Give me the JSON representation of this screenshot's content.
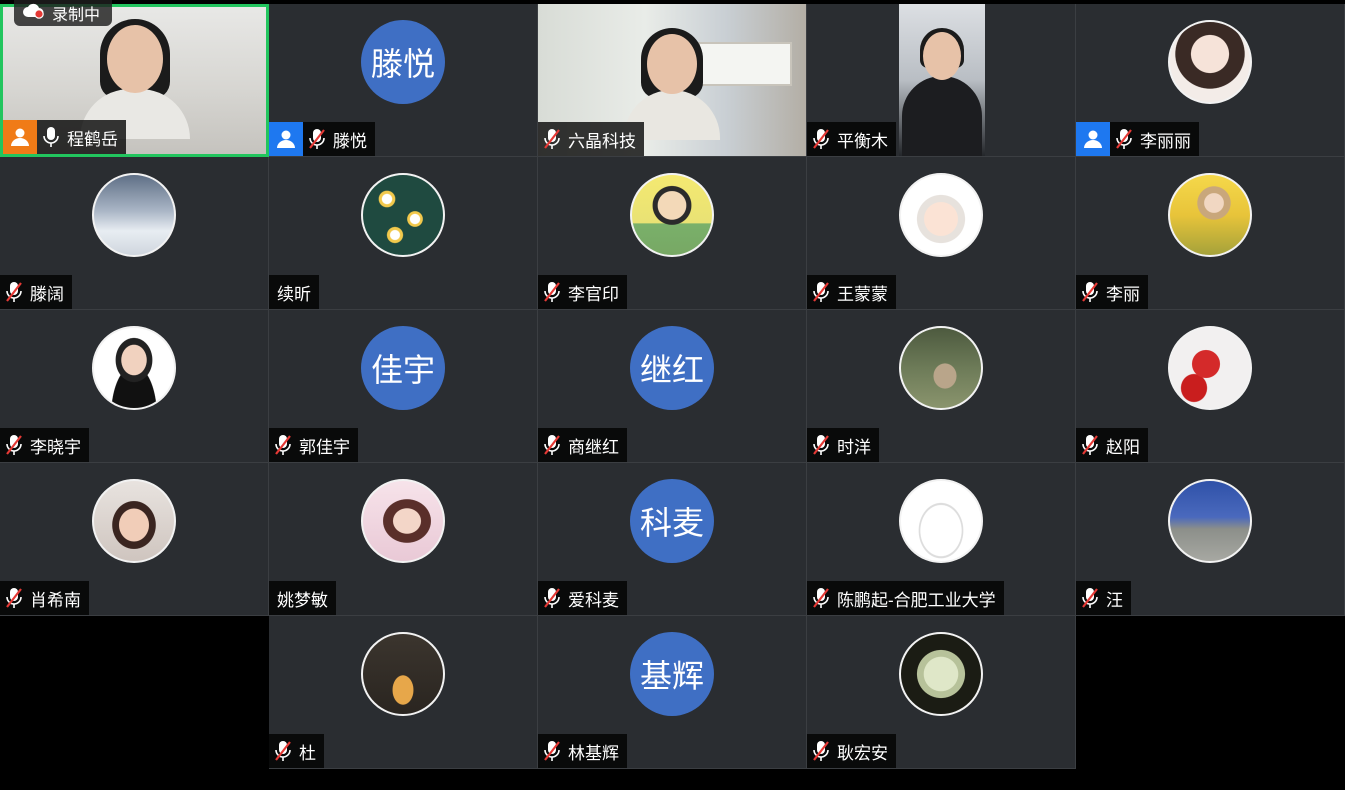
{
  "recording": {
    "label": "录制中",
    "icon": "cloud-record-icon"
  },
  "colors": {
    "active_border": "#22c55e",
    "initials_bg": "#3f6fc4",
    "host_badge": "#f07b17",
    "user_badge": "#1e78f0"
  },
  "participants": [
    {
      "name": "程鹤岳",
      "kind": "video",
      "mic": "on",
      "badge": "host"
    },
    {
      "name": "滕悦",
      "kind": "initials",
      "initials": "滕悦",
      "mic": "muted",
      "badge": "user"
    },
    {
      "name": "六晶科技",
      "kind": "video",
      "mic": "muted",
      "badge": ""
    },
    {
      "name": "平衡木",
      "kind": "video",
      "mic": "muted",
      "badge": ""
    },
    {
      "name": "李丽丽",
      "kind": "avatar",
      "mic": "muted",
      "badge": "user"
    },
    {
      "name": "滕阔",
      "kind": "avatar",
      "mic": "muted",
      "badge": ""
    },
    {
      "name": "续昕",
      "kind": "avatar",
      "mic": "none",
      "badge": ""
    },
    {
      "name": "李官印",
      "kind": "avatar",
      "mic": "muted",
      "badge": ""
    },
    {
      "name": "王蒙蒙",
      "kind": "avatar",
      "mic": "muted",
      "badge": ""
    },
    {
      "name": "李丽",
      "kind": "avatar",
      "mic": "muted",
      "badge": ""
    },
    {
      "name": "李晓宇",
      "kind": "avatar",
      "mic": "muted",
      "badge": ""
    },
    {
      "name": "郭佳宇",
      "kind": "initials",
      "initials": "佳宇",
      "mic": "muted",
      "badge": ""
    },
    {
      "name": "商继红",
      "kind": "initials",
      "initials": "继红",
      "mic": "muted",
      "badge": ""
    },
    {
      "name": "时洋",
      "kind": "avatar",
      "mic": "muted",
      "badge": ""
    },
    {
      "name": "赵阳",
      "kind": "avatar",
      "mic": "muted",
      "badge": ""
    },
    {
      "name": "肖希南",
      "kind": "avatar",
      "mic": "muted",
      "badge": ""
    },
    {
      "name": "姚梦敏",
      "kind": "avatar",
      "mic": "none",
      "badge": ""
    },
    {
      "name": "爱科麦",
      "kind": "initials",
      "initials": "科麦",
      "mic": "muted",
      "badge": ""
    },
    {
      "name": "陈鹏起-合肥工业大学",
      "kind": "avatar",
      "mic": "muted",
      "badge": ""
    },
    {
      "name": "汪",
      "kind": "avatar",
      "mic": "muted",
      "badge": ""
    },
    {
      "name": "",
      "kind": "empty"
    },
    {
      "name": "杜",
      "kind": "avatar",
      "mic": "muted",
      "badge": ""
    },
    {
      "name": "林基辉",
      "kind": "initials",
      "initials": "基辉",
      "mic": "muted",
      "badge": ""
    },
    {
      "name": "耿宏安",
      "kind": "avatar",
      "mic": "muted",
      "badge": ""
    }
  ]
}
